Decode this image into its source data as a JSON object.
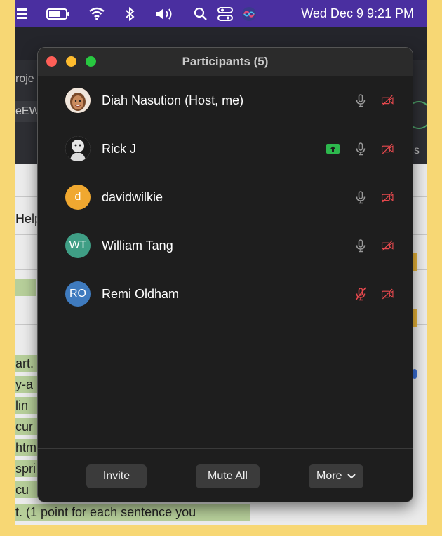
{
  "menubar": {
    "clock": "Wed Dec 9  9:21 PM",
    "background": "#4a2fa0"
  },
  "background_window": {
    "fragments": {
      "tab_text": "roje",
      "field_text": "eEW",
      "side_letter": "s",
      "menu_text": "Help"
    },
    "doc_lines": [
      "art.",
      "y-a",
      "lin",
      "cur",
      "htm",
      "spri",
      "cu",
      "t. (1 point for each sentence you"
    ]
  },
  "participants_window": {
    "title": "Participants (5)",
    "participants": [
      {
        "name": "Diah Nasution (Host, me)",
        "initials": "",
        "avatar_color": "#c98b5e",
        "avatar_kind": "photo-face",
        "sharing": false,
        "mic": "on",
        "video": "off"
      },
      {
        "name": "Rick J",
        "initials": "",
        "avatar_color": "#dddddd",
        "avatar_kind": "photo-bw",
        "sharing": true,
        "mic": "on",
        "video": "off"
      },
      {
        "name": "davidwilkie",
        "initials": "d",
        "avatar_color": "#f0a830",
        "avatar_kind": "initials",
        "sharing": false,
        "mic": "on",
        "video": "off"
      },
      {
        "name": "William Tang",
        "initials": "WT",
        "avatar_color": "#3f9e85",
        "avatar_kind": "initials",
        "sharing": false,
        "mic": "on",
        "video": "off"
      },
      {
        "name": "Remi Oldham",
        "initials": "RO",
        "avatar_color": "#3f7bbf",
        "avatar_kind": "initials",
        "sharing": false,
        "mic": "muted",
        "video": "off"
      }
    ],
    "footer": {
      "invite_label": "Invite",
      "mute_all_label": "Mute All",
      "more_label": "More"
    },
    "colors": {
      "close": "#ff5f57",
      "minimize": "#febc2e",
      "zoom": "#28c840",
      "muted_red": "#e5484d",
      "icon_grey": "#9a9a9a",
      "share_green": "#2db84d"
    }
  }
}
